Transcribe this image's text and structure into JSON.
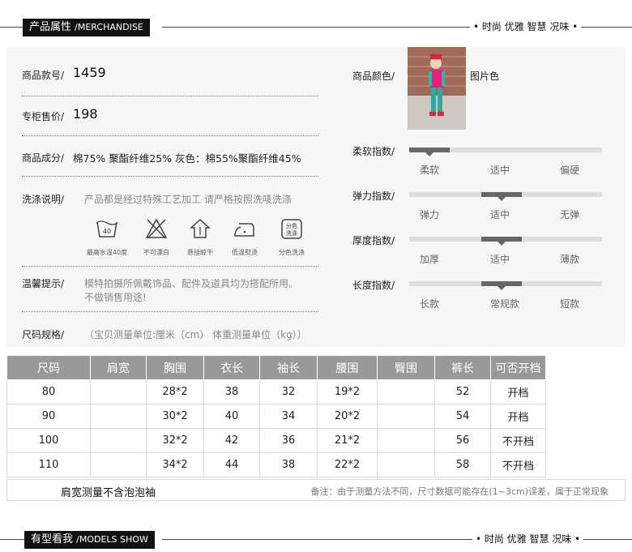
{
  "header1": {
    "title": "产品属性",
    "subtitle": "/MERCHANDISE",
    "right": "• 时尚 优雅 智慧 况味 •"
  },
  "attributes": {
    "style_no_label": "商品款号/",
    "style_no": "1459",
    "price_label": "专柜售价/",
    "price": "198",
    "composition_label": "商品成分/",
    "composition": "棉75% 聚酯纤维25% 灰色：棉55%聚酯纤维45%",
    "wash_label": "洗涤说明/",
    "wash_text": "产品都是经过特殊工艺加工 请严格按照洗唛洗涤",
    "wash_icons": [
      {
        "icon": "wash-40-icon",
        "caption": "最高水温40度",
        "num": "40"
      },
      {
        "icon": "no-bleach-icon",
        "caption": "不可漂白"
      },
      {
        "icon": "hang-dry-icon",
        "caption": "悬挂晾干"
      },
      {
        "icon": "low-iron-icon",
        "caption": "低温熨烫"
      },
      {
        "icon": "separate-wash-icon",
        "caption": "分色洗涤",
        "text": "分色洗涤"
      }
    ],
    "tip_label": "温馨提示/",
    "tip_text1": "模特拍摄所佩戴饰品、配件及道具均为搭配所用。",
    "tip_text2": "不做销售用途!",
    "color_label": "商品颜色/",
    "color": "图片色",
    "size_spec_label": "尺码规格/",
    "size_spec_note": "（宝贝测量单位:厘米（cm） 体重测量单位（kg））"
  },
  "indices": [
    {
      "label": "柔软指数/",
      "options": [
        "柔软",
        "适中",
        "偏硬"
      ],
      "level": 0
    },
    {
      "label": "弹力指数/",
      "options": [
        "弹力",
        "适中",
        "无弹"
      ],
      "level": 1
    },
    {
      "label": "厚度指数/",
      "options": [
        "加厚",
        "适中",
        "薄款"
      ],
      "level": 1
    },
    {
      "label": "长度指数/",
      "options": [
        "长款",
        "常规款",
        "短款"
      ],
      "level": 1
    }
  ],
  "size_table": {
    "headers": [
      "尺码",
      "肩宽",
      "胸围",
      "衣长",
      "袖长",
      "腰围",
      "臀围",
      "裤长",
      "可否开档"
    ],
    "rows": [
      [
        "80",
        "",
        "28*2",
        "38",
        "32",
        "19*2",
        "",
        "52",
        "开档"
      ],
      [
        "90",
        "",
        "30*2",
        "40",
        "34",
        "20*2",
        "",
        "54",
        "开档"
      ],
      [
        "100",
        "",
        "32*2",
        "42",
        "36",
        "21*2",
        "",
        "56",
        "不开档"
      ],
      [
        "110",
        "",
        "34*2",
        "44",
        "38",
        "22*2",
        "",
        "58",
        "不开档"
      ]
    ],
    "note_left": "肩宽测量不含泡泡袖",
    "note_right": "备注：由于测量方法不同，尺寸数据可能存在(1~3cm)误差，属于正常现象"
  },
  "header2": {
    "title": "有型看我",
    "subtitle": "/MODELS SHOW",
    "right": "• 时尚 优雅 智慧 况味 •"
  },
  "colors": {
    "bar": "#111111",
    "table_head": "#999999",
    "scale_track": "#dddddd",
    "scale_mark": "#666666"
  }
}
